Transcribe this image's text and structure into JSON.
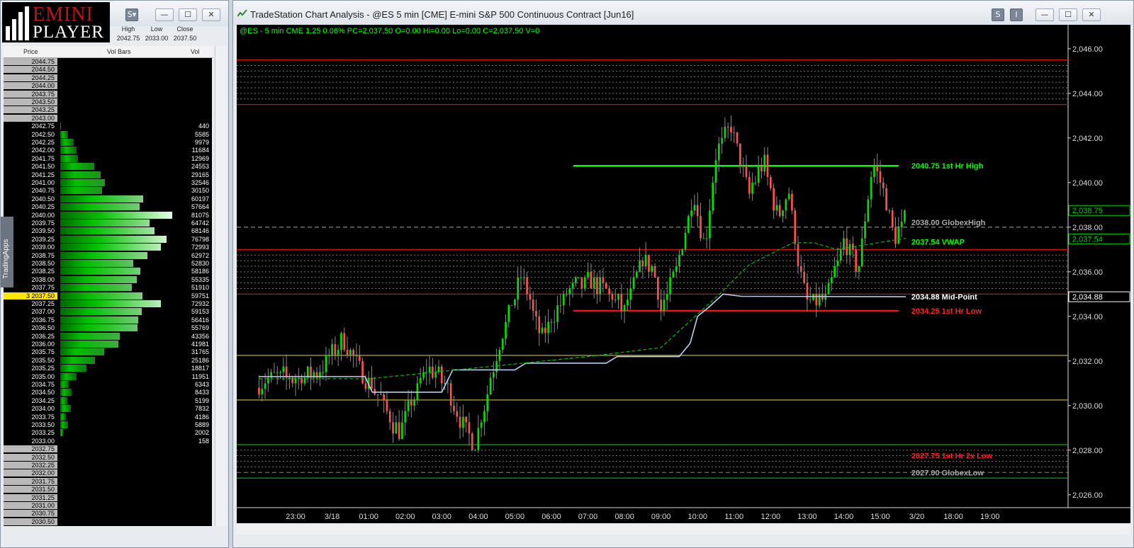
{
  "logo": {
    "line1": "EMINI",
    "line2": "PLAYER"
  },
  "hlc": {
    "headers": [
      "High",
      "Low",
      "Close"
    ],
    "values": [
      "2042.75",
      "2033.00",
      "2037.50"
    ]
  },
  "dom": {
    "headers": {
      "price": "Price",
      "bars": "Vol Bars",
      "vol": "Vol"
    },
    "side_tab": "TradingApps",
    "current_marker": "3",
    "rows": [
      {
        "price": "2044.75",
        "vol": ""
      },
      {
        "price": "2044.50",
        "vol": ""
      },
      {
        "price": "2044.25",
        "vol": ""
      },
      {
        "price": "2044.00",
        "vol": ""
      },
      {
        "price": "2043.75",
        "vol": ""
      },
      {
        "price": "2043.50",
        "vol": ""
      },
      {
        "price": "2043.25",
        "vol": ""
      },
      {
        "price": "2043.00",
        "vol": ""
      },
      {
        "price": "2042.75",
        "vol": "440"
      },
      {
        "price": "2042.50",
        "vol": "5585"
      },
      {
        "price": "2042.25",
        "vol": "9979"
      },
      {
        "price": "2042.00",
        "vol": "11684"
      },
      {
        "price": "2041.75",
        "vol": "12969"
      },
      {
        "price": "2041.50",
        "vol": "24553"
      },
      {
        "price": "2041.25",
        "vol": "29165"
      },
      {
        "price": "2041.00",
        "vol": "32546"
      },
      {
        "price": "2040.75",
        "vol": "30150"
      },
      {
        "price": "2040.50",
        "vol": "60197"
      },
      {
        "price": "2040.25",
        "vol": "57664"
      },
      {
        "price": "2040.00",
        "vol": "81075"
      },
      {
        "price": "2039.75",
        "vol": "64742"
      },
      {
        "price": "2039.50",
        "vol": "68146"
      },
      {
        "price": "2039.25",
        "vol": "76798"
      },
      {
        "price": "2039.00",
        "vol": "72993"
      },
      {
        "price": "2038.75",
        "vol": "62972"
      },
      {
        "price": "2038.50",
        "vol": "52830"
      },
      {
        "price": "2038.25",
        "vol": "58186"
      },
      {
        "price": "2038.00",
        "vol": "55335"
      },
      {
        "price": "2037.75",
        "vol": "51910"
      },
      {
        "price": "2037.50",
        "vol": "59751"
      },
      {
        "price": "2037.25",
        "vol": "72932"
      },
      {
        "price": "2037.00",
        "vol": "59153"
      },
      {
        "price": "2036.75",
        "vol": "56416"
      },
      {
        "price": "2036.50",
        "vol": "55769"
      },
      {
        "price": "2036.25",
        "vol": "43356"
      },
      {
        "price": "2036.00",
        "vol": "41981"
      },
      {
        "price": "2035.75",
        "vol": "31765"
      },
      {
        "price": "2035.50",
        "vol": "25186"
      },
      {
        "price": "2035.25",
        "vol": "18817"
      },
      {
        "price": "2035.00",
        "vol": "11951"
      },
      {
        "price": "2034.75",
        "vol": "6343"
      },
      {
        "price": "2034.50",
        "vol": "8433"
      },
      {
        "price": "2034.25",
        "vol": "5199"
      },
      {
        "price": "2034.00",
        "vol": "7832"
      },
      {
        "price": "2033.75",
        "vol": "4186"
      },
      {
        "price": "2033.50",
        "vol": "5889"
      },
      {
        "price": "2033.25",
        "vol": "2002"
      },
      {
        "price": "2033.00",
        "vol": "158"
      },
      {
        "price": "2032.75",
        "vol": ""
      },
      {
        "price": "2032.50",
        "vol": ""
      },
      {
        "price": "2032.25",
        "vol": ""
      },
      {
        "price": "2032.00",
        "vol": ""
      },
      {
        "price": "2031.75",
        "vol": ""
      },
      {
        "price": "2031.50",
        "vol": ""
      },
      {
        "price": "2031.25",
        "vol": ""
      },
      {
        "price": "2031.00",
        "vol": ""
      },
      {
        "price": "2030.75",
        "vol": ""
      },
      {
        "price": "2030.50",
        "vol": ""
      }
    ]
  },
  "window": {
    "title": "TradeStation Chart Analysis - @ES 5 min [CME] E-mini S&P 500 Continuous Contract [Jun16]",
    "btn_s": "S",
    "btn_i": "I"
  },
  "chart_data": {
    "type": "candlestick",
    "info_line": "@ES - 5 min  CME  1.25  0.06%  PC=2,037.50  O=0.00  Hi=0.00  Lo=0.00  C=2,037.50  V=0",
    "ylim": [
      2025.2,
      2046.6
    ],
    "y_ticks": [
      "2,046.00",
      "2,044.00",
      "2,042.00",
      "2,040.00",
      "2,038.00",
      "2,036.00",
      "2,034.00",
      "2,032.00",
      "2,030.00",
      "2,028.00",
      "2,026.00"
    ],
    "x_labels": [
      "23:00",
      "3/18",
      "01:00",
      "02:00",
      "03:00",
      "04:00",
      "05:00",
      "06:00",
      "07:00",
      "08:00",
      "09:00",
      "10:00",
      "11:00",
      "12:00",
      "13:00",
      "14:00",
      "15:00",
      "3/20",
      "18:00",
      "19:00"
    ],
    "last_price_tags": [
      {
        "label": "2,038.75",
        "value": 2038.75,
        "color": "#00d000"
      },
      {
        "label": "2,037.54",
        "value": 2037.54,
        "color": "#00d000"
      },
      {
        "label": "2,034.88",
        "value": 2034.88,
        "color": "#ffffff"
      }
    ],
    "levels": [
      {
        "label": "2040.75 1st Hr  High",
        "value": 2040.75,
        "color": "#00ff00"
      },
      {
        "label": "2038.00 GlobexHigh",
        "value": 2038.0,
        "color": "#aaaaaa"
      },
      {
        "label": "2037.54 VWAP",
        "value": 2037.54,
        "color": "#00ff00"
      },
      {
        "label": "2034.88 Mid-Point",
        "value": 2034.88,
        "color": "#ffffff"
      },
      {
        "label": "2034.25 1st Hr  Low",
        "value": 2034.25,
        "color": "#ff2020"
      },
      {
        "label": "2027.75 1st Hr  2x Low",
        "value": 2027.75,
        "color": "#ff2020"
      },
      {
        "label": "2027.00 GlobexLow",
        "value": 2027.0,
        "color": "#aaaaaa"
      }
    ],
    "hlines": [
      {
        "value": 2045.5,
        "color": "#d01010"
      },
      {
        "value": 2043.5,
        "color": "#d01010"
      },
      {
        "value": 2037.0,
        "color": "#d01010"
      },
      {
        "value": 2035.0,
        "color": "#d01010"
      },
      {
        "value": 2032.25,
        "color": "#d0c020"
      },
      {
        "value": 2030.25,
        "color": "#d0c020"
      },
      {
        "value": 2028.25,
        "color": "#00c000"
      },
      {
        "value": 2026.75,
        "color": "#00c000"
      }
    ],
    "dotted_bands": [
      [
        2043.75,
        2045.25
      ],
      [
        2035.25,
        2036.75
      ],
      [
        2027.25,
        2028.0
      ]
    ],
    "signals_down": [
      [
        10.3,
        2042.55
      ],
      [
        11.5,
        2041.85
      ],
      [
        12.1,
        2040.3
      ]
    ],
    "signals_up": [
      [
        8.9,
        2034.35
      ],
      [
        12.4,
        2034.5
      ]
    ],
    "series_anchor_time": [
      22.0,
      22.4,
      23.0,
      23.6,
      24.3,
      24.8,
      25.3,
      25.8,
      26.3,
      26.6,
      27.1,
      27.5,
      27.9,
      28.3,
      28.7,
      29.2,
      29.7,
      30.2,
      30.6,
      31.1,
      31.6,
      32.0,
      32.5,
      32.8,
      33.0,
      33.4,
      33.9,
      34.2,
      34.5,
      34.9,
      35.4,
      35.8,
      36.2,
      36.5,
      36.8,
      37.0,
      37.5,
      38.0,
      38.4,
      38.8,
      39.1,
      39.4,
      39.7
    ],
    "series_anchor_close": [
      2030.8,
      2031.4,
      2031.2,
      2031.5,
      2033.0,
      2031.5,
      2030.4,
      2028.8,
      2030.6,
      2031.8,
      2031.0,
      2029.3,
      2028.1,
      2031.0,
      2033.5,
      2035.9,
      2033.0,
      2034.5,
      2035.3,
      2035.6,
      2035.0,
      2034.3,
      2036.5,
      2036.0,
      2034.3,
      2036.0,
      2039.5,
      2037.0,
      2041.3,
      2042.5,
      2039.5,
      2041.0,
      2038.4,
      2039.6,
      2036.0,
      2034.7,
      2034.7,
      2037.3,
      2036.1,
      2041.0,
      2039.5,
      2037.5,
      2038.5
    ],
    "vwap": [
      [
        22.0,
        2031.2
      ],
      [
        25.0,
        2031.2
      ],
      [
        28.0,
        2031.7
      ],
      [
        31.0,
        2032.2
      ],
      [
        33.0,
        2032.6
      ],
      [
        34.6,
        2035.0
      ],
      [
        35.4,
        2036.3
      ],
      [
        36.6,
        2037.3
      ],
      [
        37.2,
        2037.3
      ],
      [
        37.8,
        2037.0
      ],
      [
        39.7,
        2037.5
      ]
    ],
    "midpoint": [
      [
        22.0,
        2031.3
      ],
      [
        24.9,
        2031.3
      ],
      [
        25.1,
        2030.6
      ],
      [
        27.0,
        2030.6
      ],
      [
        27.3,
        2031.6
      ],
      [
        29.0,
        2031.6
      ],
      [
        29.3,
        2031.9
      ],
      [
        31.5,
        2031.9
      ],
      [
        31.8,
        2032.2
      ],
      [
        33.5,
        2032.2
      ],
      [
        33.8,
        2032.8
      ],
      [
        34.0,
        2034.0
      ],
      [
        34.3,
        2034.4
      ],
      [
        34.7,
        2035.0
      ],
      [
        35.2,
        2034.9
      ],
      [
        39.7,
        2034.88
      ]
    ]
  }
}
